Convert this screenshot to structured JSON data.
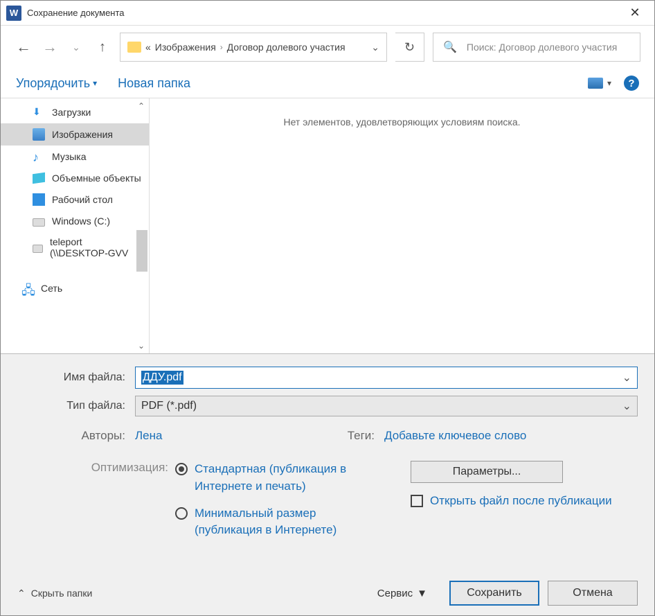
{
  "window": {
    "title": "Сохранение документа"
  },
  "breadcrumb": {
    "prefix": "«",
    "seg1": "Изображения",
    "seg2": "Договор долевого участия"
  },
  "search": {
    "placeholder": "Поиск: Договор долевого участия"
  },
  "toolbar": {
    "organize": "Упорядочить",
    "new_folder": "Новая папка"
  },
  "tree": {
    "downloads": "Загрузки",
    "images": "Изображения",
    "music": "Музыка",
    "objects3d": "Объемные объекты",
    "desktop": "Рабочий стол",
    "drive_c": "Windows  (C:)",
    "teleport": "teleport (\\\\DESKTOP-GVV",
    "network": "Сеть"
  },
  "content": {
    "empty": "Нет элементов, удовлетворяющих условиям поиска."
  },
  "fields": {
    "filename_label": "Имя файла:",
    "filename_value": "ДДУ.pdf",
    "filetype_label": "Тип файла:",
    "filetype_value": "PDF (*.pdf)",
    "authors_label": "Авторы:",
    "authors_value": "Лена",
    "tags_label": "Теги:",
    "tags_value": "Добавьте ключевое слово"
  },
  "optimize": {
    "label": "Оптимизация:",
    "opt1": "Стандартная (публикация в Интернете и печать)",
    "opt2": "Минимальный размер (публикация в Интернете)"
  },
  "params_button": "Параметры...",
  "open_after": "Открыть файл после публикации",
  "footer": {
    "hide": "Скрыть папки",
    "service": "Сервис",
    "save": "Сохранить",
    "cancel": "Отмена"
  }
}
